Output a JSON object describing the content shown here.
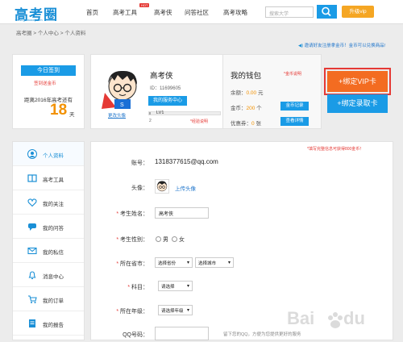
{
  "header": {
    "logo": "高考圈",
    "logo_sub": "www.gaokaoq.com",
    "nav": [
      "首页",
      "高考工具",
      "高考侠",
      "问答社区",
      "高考攻略"
    ],
    "hot_badge": "HOT",
    "search_placeholder": "搜索大学",
    "upgrade_label": "升级vip"
  },
  "breadcrumb": "高考圈 > 个人中心 > 个人资料",
  "notice": "邀请好友注册拿金币！金币可以兑换商品!",
  "sign": {
    "button": "今日签到",
    "sub": "签到送金币",
    "countdown_label": "距离2016年高考还有",
    "days": "18",
    "days_unit": "天"
  },
  "profile": {
    "name": "高考侠",
    "id_text": "ID：11699605",
    "service_button": "我的服务中心",
    "change_avatar": "更改头像",
    "level_label": "LV1",
    "level_num": "2",
    "exp_help": "*经验说明",
    "level_progress": 0.02
  },
  "wallet": {
    "title": "我的钱包",
    "coin_help": "*金币说明",
    "rows": [
      {
        "label": "余额：",
        "value": "0.00",
        "unit": "元",
        "button": ""
      },
      {
        "label": "金币：",
        "value": "200",
        "unit": "个",
        "button": "金币记录"
      },
      {
        "label": "优惠券：",
        "value": "0",
        "unit": "张",
        "button": "查看详情"
      }
    ]
  },
  "actions": {
    "vip": "+绑定VIP卡",
    "card": "+绑定录取卡"
  },
  "sidebar": [
    {
      "label": "个人资料",
      "icon": "user-icon",
      "active": true
    },
    {
      "label": "高考工具",
      "icon": "book-icon",
      "active": false
    },
    {
      "label": "我的关注",
      "icon": "heart-icon",
      "active": false
    },
    {
      "label": "我的问答",
      "icon": "chat-icon",
      "active": false
    },
    {
      "label": "我的私信",
      "icon": "mail-icon",
      "active": false
    },
    {
      "label": "消息中心",
      "icon": "bell-icon",
      "active": false
    },
    {
      "label": "我的订单",
      "icon": "cart-icon",
      "active": false
    },
    {
      "label": "我的报告",
      "icon": "report-icon",
      "active": false
    }
  ],
  "form": {
    "tip": "*填写完整信息可获得800金币！",
    "account_label": "账号：",
    "account_value": "1318377615@qq.com",
    "avatar_label": "头像：",
    "upload_label": "上传头像",
    "name_label": "考生姓名：",
    "name_value": "高考侠",
    "gender_label": "考生性别：",
    "gender_male": "男",
    "gender_female": "女",
    "province_label": "所在省市：",
    "province_select": "选择省份",
    "city_select": "选择城市",
    "subject_label": "科目：",
    "subject_select": "请选择",
    "grade_label": "所在年级：",
    "grade_select": "请选择年级",
    "qq_label": "QQ号码：",
    "qq_hint": "留下您的QQ，方便为您提供更好的服务"
  },
  "colors": {
    "accent": "#1a9be6",
    "orange": "#f36c21",
    "red": "#e53935"
  }
}
